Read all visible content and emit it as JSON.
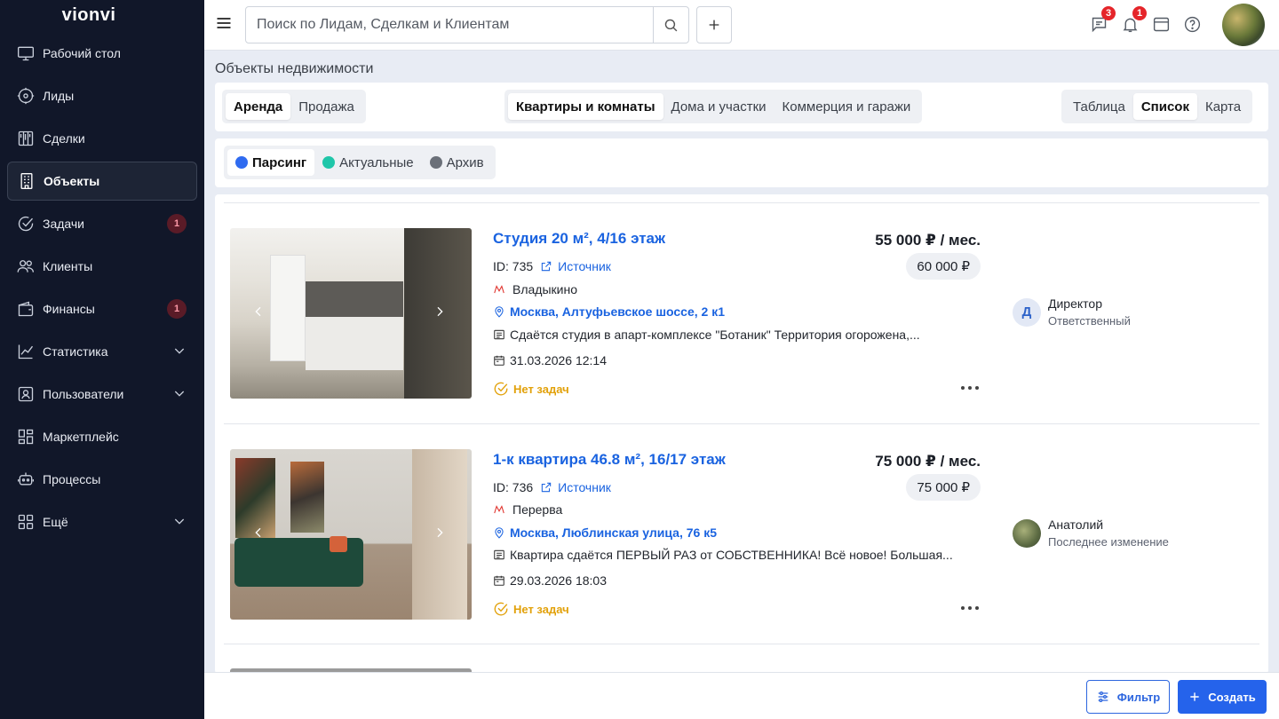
{
  "app": {
    "logo": "vionvi"
  },
  "sidebar": {
    "items": [
      {
        "label": "Рабочий стол",
        "icon": "monitor-icon"
      },
      {
        "label": "Лиды",
        "icon": "target-icon"
      },
      {
        "label": "Сделки",
        "icon": "kanban-icon"
      },
      {
        "label": "Объекты",
        "icon": "building-icon",
        "active": true
      },
      {
        "label": "Задачи",
        "icon": "check-circle-icon",
        "badge": "1"
      },
      {
        "label": "Клиенты",
        "icon": "users-icon"
      },
      {
        "label": "Финансы",
        "icon": "wallet-icon",
        "badge": "1"
      },
      {
        "label": "Статистика",
        "icon": "chart-line-icon",
        "expandable": true
      },
      {
        "label": "Пользователи",
        "icon": "user-card-icon",
        "expandable": true
      },
      {
        "label": "Маркетплейс",
        "icon": "grid-icon"
      },
      {
        "label": "Процессы",
        "icon": "robot-icon"
      },
      {
        "label": "Ещё",
        "icon": "apps-icon",
        "expandable": true
      }
    ]
  },
  "topbar": {
    "search_placeholder": "Поиск по Лидам, Сделкам и Клиентам",
    "messages_badge": "3",
    "notifications_badge": "1"
  },
  "page": {
    "title": "Объекты недвижимости"
  },
  "deal_tabs": [
    "Аренда",
    "Продажа"
  ],
  "type_tabs": [
    "Квартиры и комнаты",
    "Дома и участки",
    "Коммерция и гаражи"
  ],
  "view_tabs": [
    "Таблица",
    "Список",
    "Карта"
  ],
  "status_tabs": [
    {
      "label": "Парсинг",
      "color": "#2f6bf0"
    },
    {
      "label": "Актуальные",
      "color": "#1fc6a9"
    },
    {
      "label": "Архив",
      "color": "#6b7079"
    }
  ],
  "listings": [
    {
      "title": "Студия 20 м², 4/16 этаж",
      "price": "55 000 ₽ / мес.",
      "price_alt": "60 000 ₽",
      "id_label": "ID: 735",
      "source": "Источник",
      "metro": "Владыкино",
      "address": "Москва, Алтуфьевское шоссе, 2 к1",
      "description": "Сдаётся студия в апарт-комплексе \"Ботаник\" Территория огорожена,...",
      "date": "31.03.2026 12:14",
      "tasks": "Нет задач",
      "responsible_initial": "Д",
      "responsible_name": "Директор",
      "responsible_role": "Ответственный"
    },
    {
      "title": "1-к квартира 46.8 м², 16/17 этаж",
      "price": "75 000 ₽ / мес.",
      "price_alt": "75 000 ₽",
      "id_label": "ID: 736",
      "source": "Источник",
      "metro": "Перерва",
      "address": "Москва, Люблинская улица, 76 к5",
      "description": "Квартира сдаётся ПЕРВЫЙ РАЗ от СОБСТВЕННИКА! Всё новое! Большая...",
      "date": "29.03.2026 18:03",
      "tasks": "Нет задач",
      "responsible_initial": "",
      "responsible_name": "Анатолий",
      "responsible_role": "Последнее изменение"
    }
  ],
  "bottombar": {
    "filter_label": "Фильтр",
    "create_label": "Создать"
  },
  "colors": {
    "sidebar_bg": "#111729",
    "accent": "#2563eb",
    "link": "#1a63e0",
    "warning": "#e2a10a",
    "badge": "#e5252a"
  }
}
